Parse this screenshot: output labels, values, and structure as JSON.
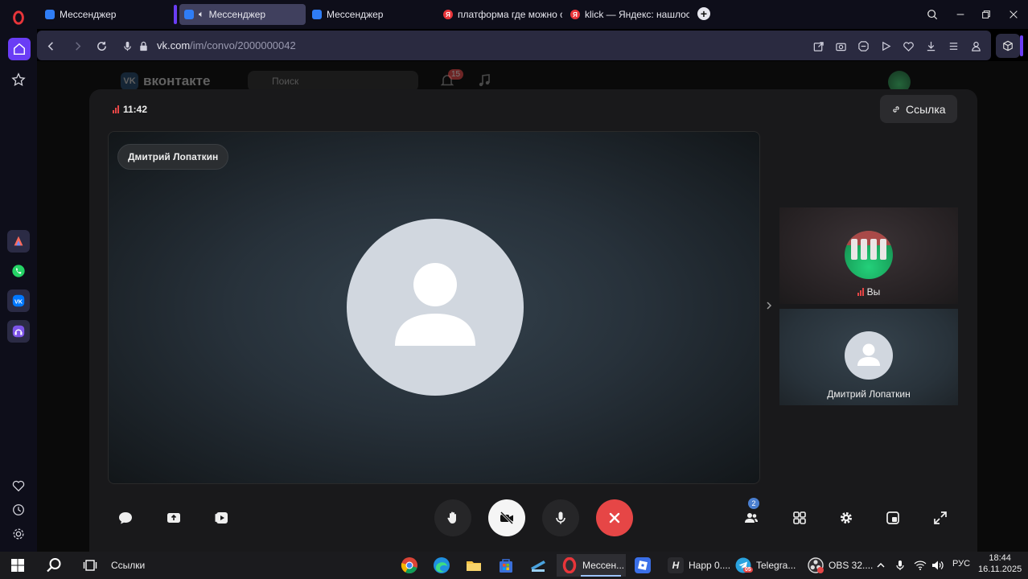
{
  "tabs": [
    {
      "label": "Мессенджер",
      "favicon": "message-icon"
    },
    {
      "label": "Мессенджер",
      "favicon": "message-icon",
      "active": true,
      "audio": true
    },
    {
      "label": "Мессенджер",
      "favicon": "message-icon"
    },
    {
      "label": "платформа где можно ст",
      "favicon": "yandex-icon"
    },
    {
      "label": "klick — Яндекс: нашлось",
      "favicon": "yandex-icon"
    }
  ],
  "address": {
    "host": "vk.com",
    "path": "/im/convo/2000000042"
  },
  "vk": {
    "logo_text": "вконтакте",
    "search_placeholder": "Поиск",
    "notif_count": "15"
  },
  "call": {
    "duration": "11:42",
    "link_label": "Ссылка",
    "main_participant": "Дмитрий Лопаткин",
    "tiles": [
      {
        "name": "Вы"
      },
      {
        "name": "Дмитрий Лопаткин"
      }
    ],
    "participants_count": "2"
  },
  "taskbar": {
    "search_label": "Ссылки",
    "apps": [
      {
        "label": "Мессен...",
        "active": true
      },
      {
        "label": "Happ 0...."
      },
      {
        "label": "Telegra..."
      },
      {
        "label": "OBS 32...."
      }
    ],
    "telegram_badge": "05",
    "lang": "РУС",
    "time": "18:44",
    "date": "16.11.2025"
  },
  "colors": {
    "accent": "#6a3df5",
    "end_call": "#e64646",
    "vk_blue": "#2a5885"
  }
}
